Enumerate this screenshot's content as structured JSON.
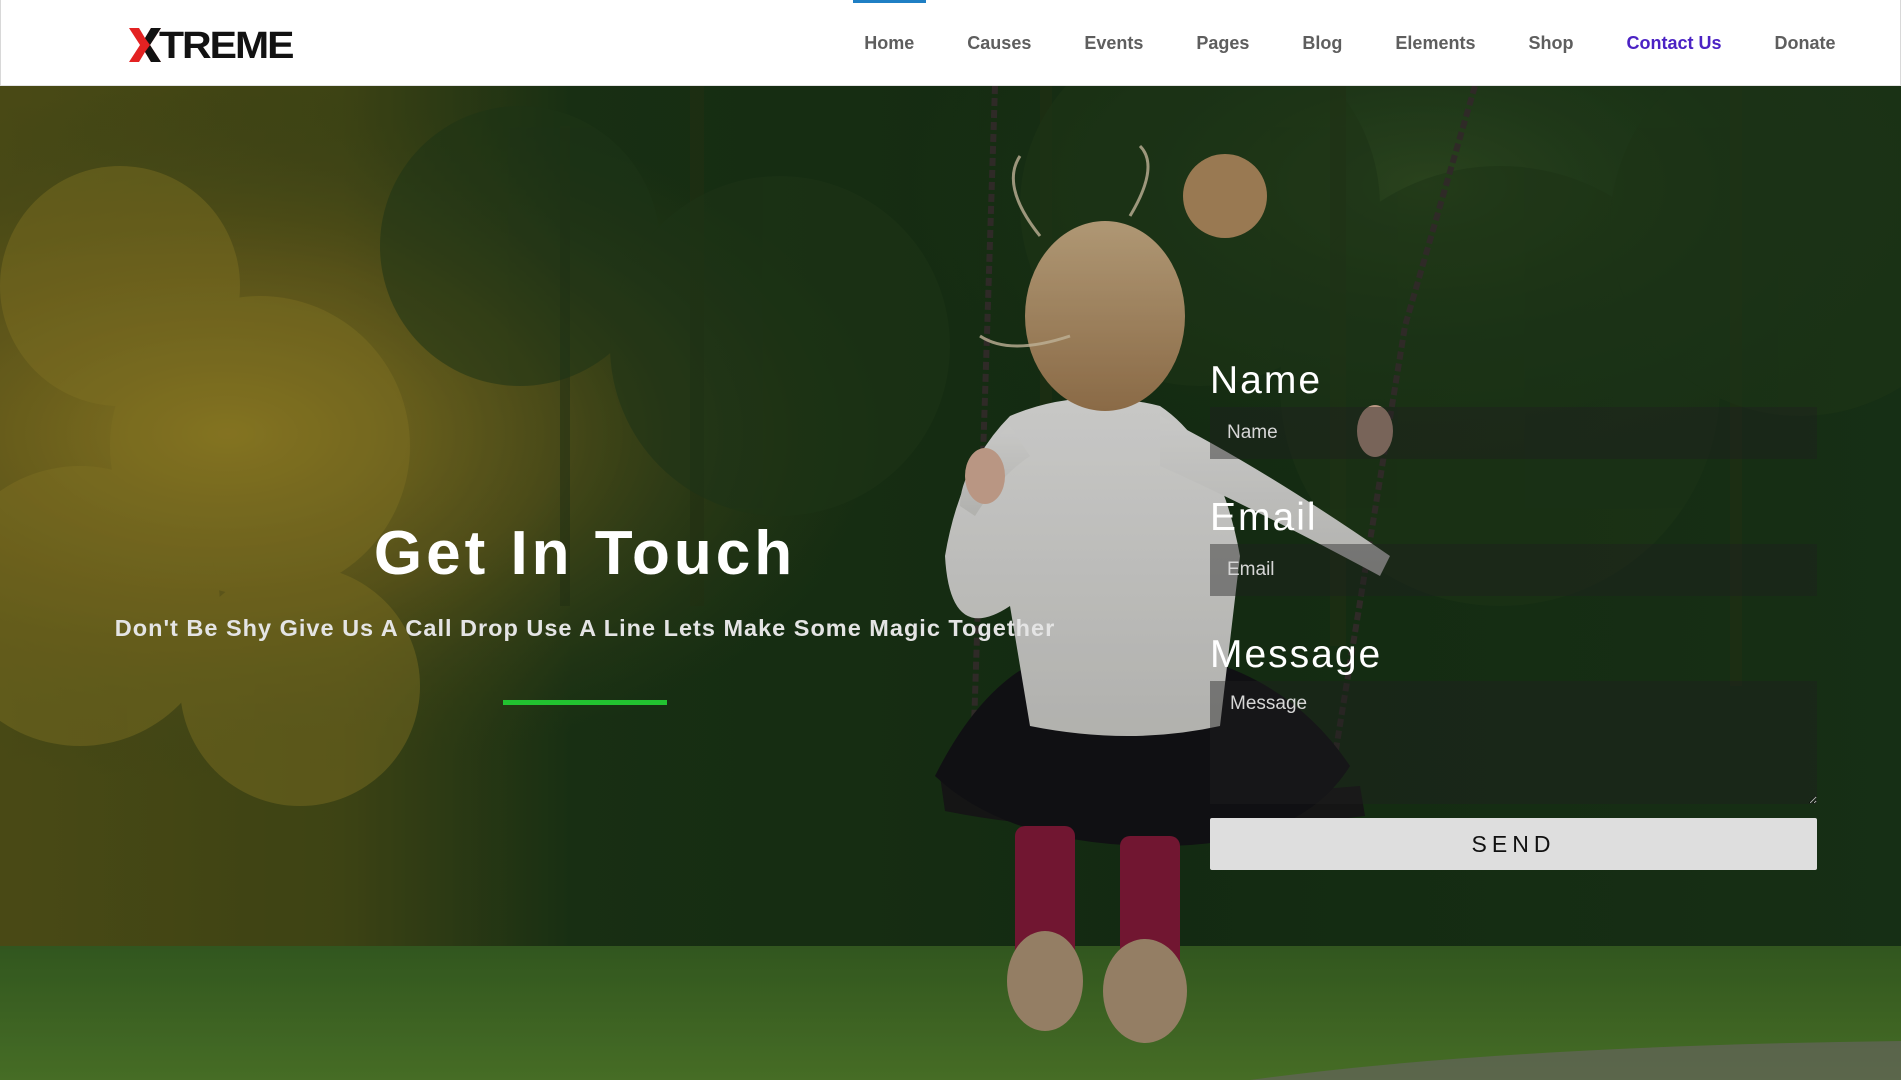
{
  "header": {
    "logo_text": "TREME",
    "logo_full": "XTREME",
    "nav": [
      {
        "label": "Home"
      },
      {
        "label": "Causes"
      },
      {
        "label": "Events"
      },
      {
        "label": "Pages"
      },
      {
        "label": "Blog"
      },
      {
        "label": "Elements"
      },
      {
        "label": "Shop"
      },
      {
        "label": "Contact Us",
        "current": true
      },
      {
        "label": "Donate"
      }
    ]
  },
  "hero": {
    "title": "Get In Touch",
    "tagline": "Don't Be Shy Give Us A Call Drop Use A Line Lets Make Some Magic Together",
    "divider_color": "#22c230"
  },
  "form": {
    "name_label": "Name",
    "name_placeholder": "Name",
    "email_label": "Email",
    "email_placeholder": "Email",
    "message_label": "Message",
    "message_placeholder": "Message",
    "send_label": "SEND"
  },
  "colors": {
    "nav_text": "#5e5e5e",
    "nav_current": "#4b22c4",
    "nav_indicator": "#1f7fc4",
    "logo_accent": "#e32222"
  }
}
